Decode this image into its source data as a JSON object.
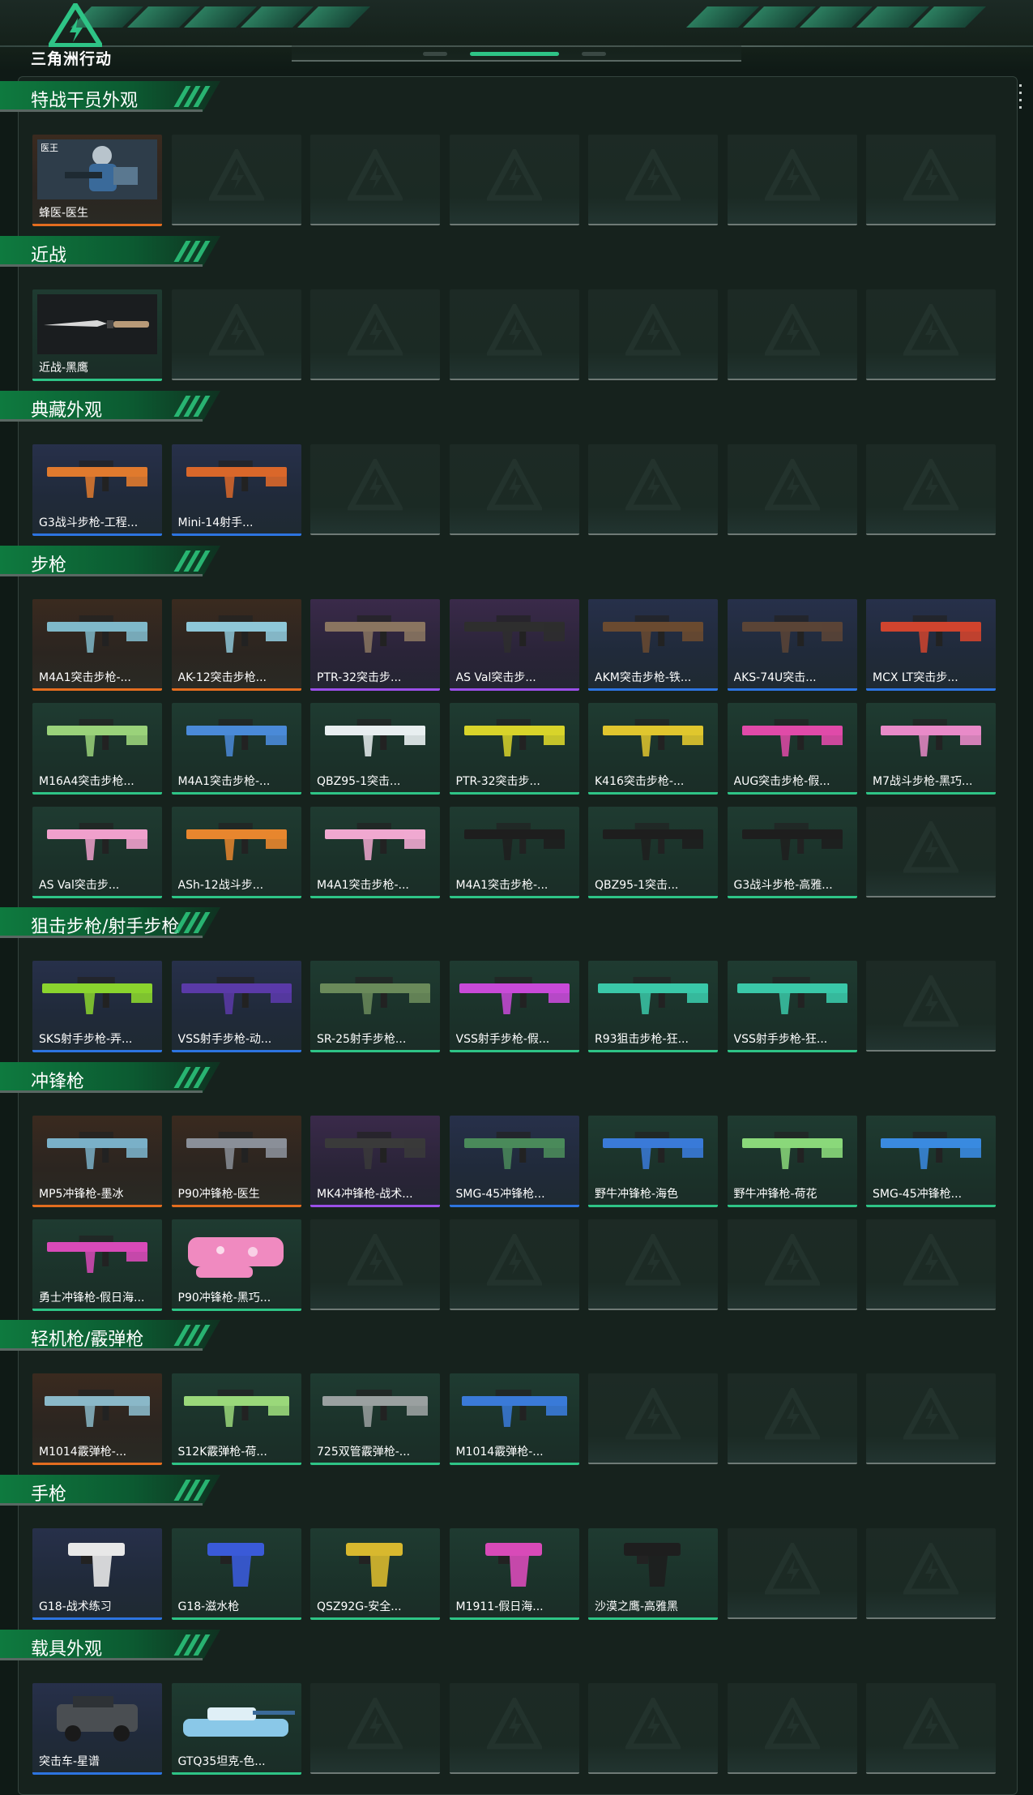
{
  "header": {
    "logo_text": "三角洲行动",
    "accent": "#2ec486",
    "icons": [
      "delta-triangle-logo-icon"
    ]
  },
  "colors": {
    "common_border": "#2ec486",
    "rare_border": "#2d74e0",
    "epic_border": "#9a4fe8",
    "legendary_border": "#e36d1f",
    "section_green": "#0e7a3f"
  },
  "sections": [
    {
      "title": "特战干员外观",
      "items": [
        {
          "label": "蜂医-医生",
          "rarity": "orange",
          "kind": "operator",
          "badge": "医王"
        }
      ]
    },
    {
      "title": "近战",
      "items": [
        {
          "label": "近战-黑鹰",
          "rarity": "green",
          "kind": "knife"
        }
      ]
    },
    {
      "title": "典藏外观",
      "items": [
        {
          "label": "G3战斗步枪-工程...",
          "rarity": "blue",
          "kind": "rifle",
          "color": "#e07a2e"
        },
        {
          "label": "Mini-14射手...",
          "rarity": "blue",
          "kind": "rifle",
          "color": "#d9672a"
        }
      ]
    },
    {
      "title": "步枪",
      "items": [
        {
          "label": "M4A1突击步枪-...",
          "rarity": "orange",
          "kind": "rifle",
          "color": "#7fb8c9"
        },
        {
          "label": "AK-12突击步枪...",
          "rarity": "orange",
          "kind": "rifle",
          "color": "#8ec7d8"
        },
        {
          "label": "PTR-32突击步...",
          "rarity": "purple",
          "kind": "rifle",
          "color": "#8a7560"
        },
        {
          "label": "AS Val突击步...",
          "rarity": "purple",
          "kind": "rifle",
          "color": "#2e2e2e"
        },
        {
          "label": "AKM突击步枪-铁...",
          "rarity": "blue",
          "kind": "rifle",
          "color": "#6a4a30"
        },
        {
          "label": "AKS-74U突击...",
          "rarity": "blue",
          "kind": "rifle",
          "color": "#5a4436"
        },
        {
          "label": "MCX LT突击步...",
          "rarity": "blue",
          "kind": "rifle",
          "color": "#d0442e"
        },
        {
          "label": "M16A4突击步枪...",
          "rarity": "green",
          "kind": "rifle",
          "color": "#9ad27a"
        },
        {
          "label": "M4A1突击步枪-...",
          "rarity": "green",
          "kind": "rifle",
          "color": "#4a8ad8"
        },
        {
          "label": "QBZ95-1突击...",
          "rarity": "green",
          "kind": "rifle",
          "color": "#e8eef0"
        },
        {
          "label": "PTR-32突击步...",
          "rarity": "green",
          "kind": "rifle",
          "color": "#d8d42a"
        },
        {
          "label": "K416突击步枪-...",
          "rarity": "green",
          "kind": "rifle",
          "color": "#e0c62e"
        },
        {
          "label": "AUG突击步枪-假...",
          "rarity": "green",
          "kind": "rifle",
          "color": "#e04aa8"
        },
        {
          "label": "M7战斗步枪-黑巧...",
          "rarity": "green",
          "kind": "rifle",
          "color": "#e88ac8"
        },
        {
          "label": "AS Val突击步...",
          "rarity": "green",
          "kind": "rifle",
          "color": "#f0a0cc"
        },
        {
          "label": "ASh-12战斗步...",
          "rarity": "green",
          "kind": "rifle",
          "color": "#e8862e"
        },
        {
          "label": "M4A1突击步枪-...",
          "rarity": "green",
          "kind": "rifle",
          "color": "#f0a8d0"
        },
        {
          "label": "M4A1突击步枪-...",
          "rarity": "green",
          "kind": "rifle",
          "color": "#1e1e1e"
        },
        {
          "label": "QBZ95-1突击...",
          "rarity": "green",
          "kind": "rifle",
          "color": "#1e1e1e"
        },
        {
          "label": "G3战斗步枪-高雅...",
          "rarity": "green",
          "kind": "rifle",
          "color": "#1e1e1e"
        }
      ]
    },
    {
      "title": "狙击步枪/射手步枪",
      "items": [
        {
          "label": "SKS射手步枪-弄...",
          "rarity": "blue",
          "kind": "sniper",
          "color": "#8ad42e"
        },
        {
          "label": "VSS射手步枪-动...",
          "rarity": "blue",
          "kind": "sniper",
          "color": "#5a3aa8"
        },
        {
          "label": "SR-25射手步枪...",
          "rarity": "green",
          "kind": "sniper",
          "color": "#6a8a5a"
        },
        {
          "label": "VSS射手步枪-假...",
          "rarity": "green",
          "kind": "sniper",
          "color": "#c84ad8"
        },
        {
          "label": "R93狙击步枪-狂...",
          "rarity": "green",
          "kind": "sniper",
          "color": "#3ac8a8"
        },
        {
          "label": "VSS射手步枪-狂...",
          "rarity": "green",
          "kind": "sniper",
          "color": "#3ac8a8"
        }
      ]
    },
    {
      "title": "冲锋枪",
      "items": [
        {
          "label": "MP5冲锋枪-墨冰",
          "rarity": "orange",
          "kind": "smg",
          "color": "#7ab0c8"
        },
        {
          "label": "P90冲锋枪-医生",
          "rarity": "orange",
          "kind": "smg",
          "color": "#8a8f98"
        },
        {
          "label": "MK4冲锋枪-战术...",
          "rarity": "purple",
          "kind": "smg",
          "color": "#3a3a3a"
        },
        {
          "label": "SMG-45冲锋枪...",
          "rarity": "blue",
          "kind": "smg",
          "color": "#4a8a5a"
        },
        {
          "label": "野牛冲锋枪-海色",
          "rarity": "green",
          "kind": "smg",
          "color": "#3a7ad8"
        },
        {
          "label": "野牛冲锋枪-荷花",
          "rarity": "green",
          "kind": "smg",
          "color": "#8ad87a"
        },
        {
          "label": "SMG-45冲锋枪...",
          "rarity": "green",
          "kind": "smg",
          "color": "#3a8ae0"
        },
        {
          "label": "勇士冲锋枪-假日海...",
          "rarity": "green",
          "kind": "smg",
          "color": "#d84ab8"
        },
        {
          "label": "P90冲锋枪-黑巧...",
          "rarity": "green",
          "kind": "p90",
          "color": "#f08ac0"
        }
      ]
    },
    {
      "title": "轻机枪/霰弹枪",
      "items": [
        {
          "label": "M1014霰弹枪-...",
          "rarity": "orange",
          "kind": "shotgun",
          "color": "#8ab8c8"
        },
        {
          "label": "S12K霰弹枪-荷...",
          "rarity": "green",
          "kind": "shotgun",
          "color": "#9ad87a"
        },
        {
          "label": "725双管霰弹枪-...",
          "rarity": "green",
          "kind": "shotgun",
          "color": "#9aa0a0"
        },
        {
          "label": "M1014霰弹枪-...",
          "rarity": "green",
          "kind": "shotgun",
          "color": "#3a7ad8"
        }
      ]
    },
    {
      "title": "手枪",
      "items": [
        {
          "label": "G18-战术练习",
          "rarity": "blue",
          "kind": "pistol",
          "color": "#e8e8e8"
        },
        {
          "label": "G18-滋水枪",
          "rarity": "green",
          "kind": "pistol",
          "color": "#3a5ad8"
        },
        {
          "label": "QSZ92G-安全...",
          "rarity": "green",
          "kind": "pistol",
          "color": "#d8b82e"
        },
        {
          "label": "M1911-假日海...",
          "rarity": "green",
          "kind": "pistol",
          "color": "#d84ab8"
        },
        {
          "label": "沙漠之鹰-高雅黑",
          "rarity": "green",
          "kind": "pistol",
          "color": "#1e1e1e"
        }
      ]
    },
    {
      "title": "载具外观",
      "items": [
        {
          "label": "突击车-星谱",
          "rarity": "blue",
          "kind": "vehicle",
          "color": "#4a4e52"
        },
        {
          "label": "GTQ35坦克-色...",
          "rarity": "green",
          "kind": "tank",
          "color": "#8ac8e8"
        }
      ]
    }
  ]
}
